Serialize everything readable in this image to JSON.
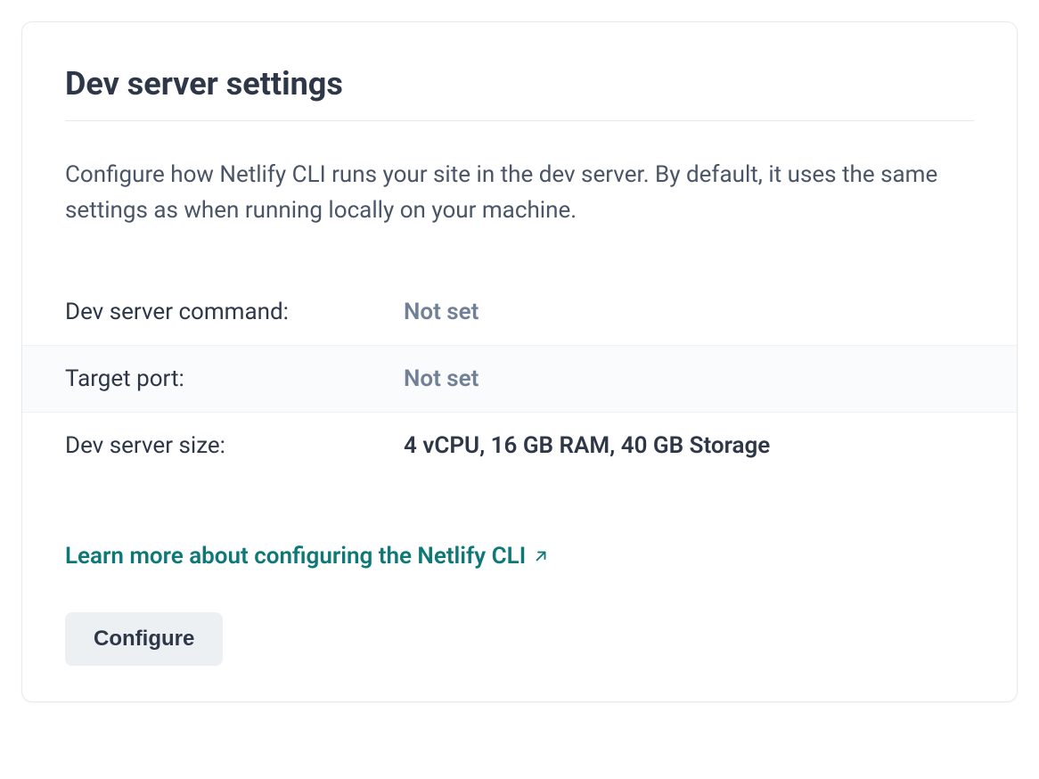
{
  "card": {
    "title": "Dev server settings",
    "description": "Configure how Netlify CLI runs your site in the dev server. By default, it uses the same settings as when running locally on your machine.",
    "settings": {
      "command_label": "Dev server command:",
      "command_value": "Not set",
      "port_label": "Target port:",
      "port_value": "Not set",
      "size_label": "Dev server size:",
      "size_value": "4 vCPU, 16 GB RAM, 40 GB Storage"
    },
    "learn_link": "Learn more about configuring the Netlify CLI",
    "configure_button": "Configure"
  }
}
